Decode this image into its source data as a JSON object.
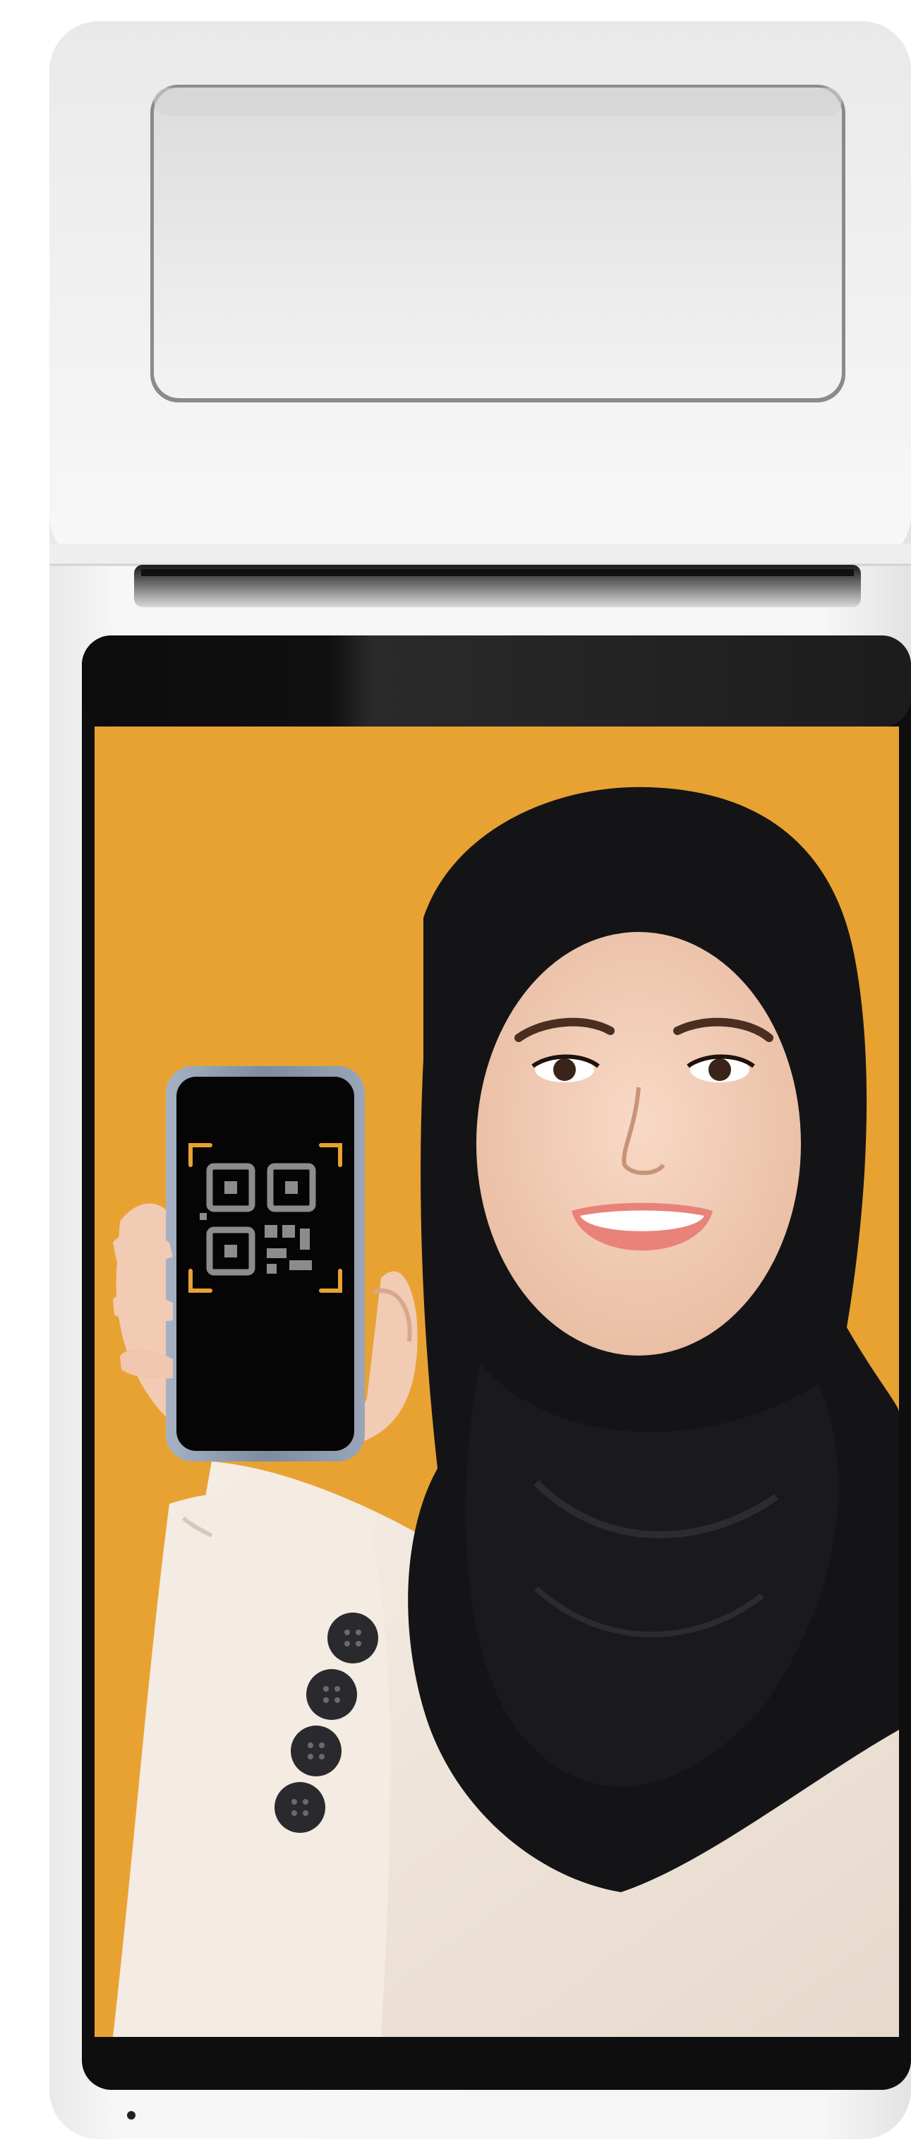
{
  "device": {
    "type": "pos-terminal",
    "body_color": "#f4f4f4",
    "screen_bezel_color": "#0e0e0e"
  },
  "display": {
    "background_color": "#e8a232",
    "content": "person-holding-phone-with-qr-code"
  },
  "phone": {
    "frame_color": "#8e9bb1",
    "screen_color": "#050505",
    "qr_color": "#8c8c8c",
    "corner_bracket_color": "#e8a232",
    "icon": "qr-code-icon"
  },
  "person": {
    "hijab_color": "#141416",
    "skin_color": "#f2cfb8",
    "blazer_color": "#f1e6dc",
    "button_color": "#2a2a2e"
  }
}
